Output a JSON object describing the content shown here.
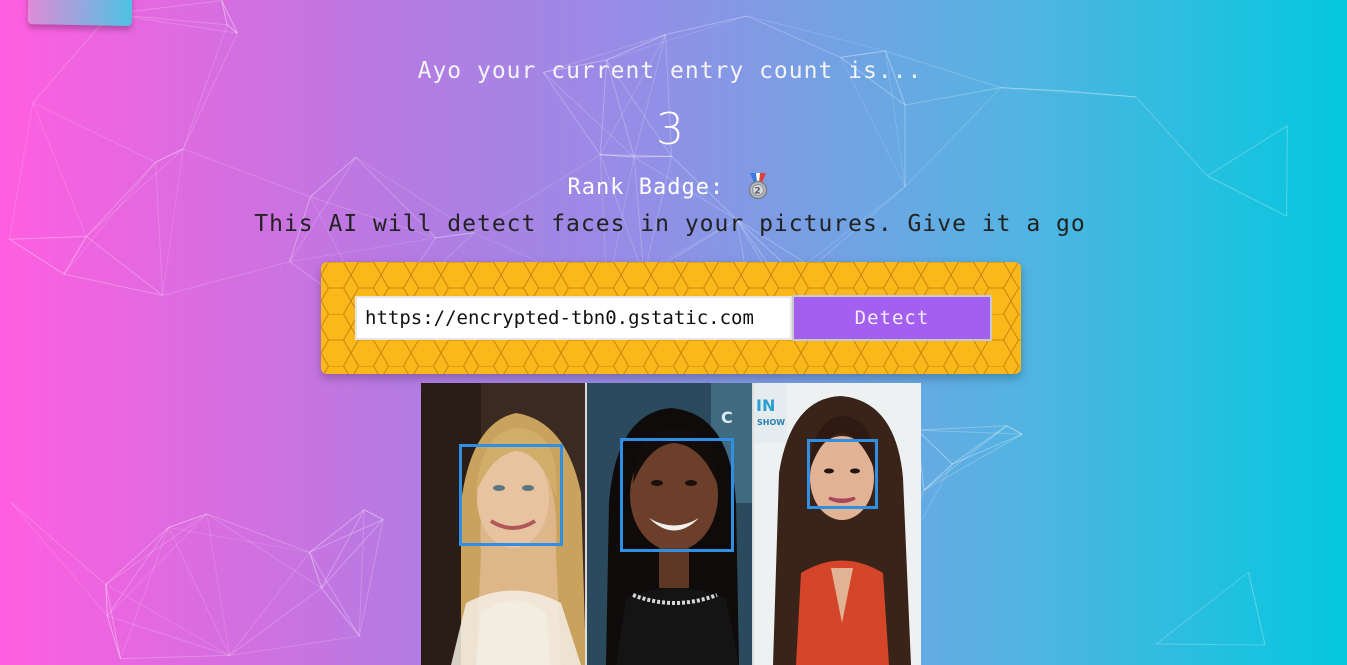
{
  "intro_text": "Ayo your current entry count is...",
  "entry_count": "3",
  "rank": {
    "label": "Rank Badge:",
    "badge_icon": "silver-medal-2"
  },
  "description": "This AI will detect faces in your pictures. Give it a go",
  "form": {
    "url_value": "https://encrypted-tbn0.gstatic.com",
    "detect_label": "Detect"
  },
  "result_image": {
    "photos": [
      "blonde-woman",
      "smiling-woman",
      "brunette-woman"
    ],
    "face_count": 3
  },
  "colors": {
    "gradient_left": "#ff5edf",
    "gradient_right": "#04c8de",
    "panel": "#fbb81a",
    "button": "#a35ff0",
    "face_box": "#2f8fe5"
  }
}
